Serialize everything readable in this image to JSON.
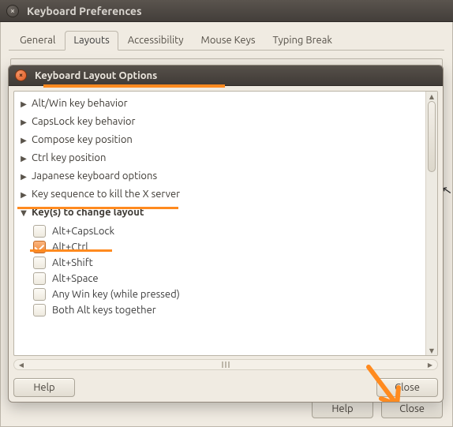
{
  "outer": {
    "title": "Keyboard Preferences",
    "tabs": [
      "General",
      "Layouts",
      "Accessibility",
      "Mouse Keys",
      "Typing Break"
    ],
    "active_tab_index": 1,
    "help_label": "Help",
    "close_label": "Close"
  },
  "dialog": {
    "title": "Keyboard Layout Options",
    "groups": [
      {
        "label": "Alt/Win key behavior",
        "expanded": false
      },
      {
        "label": "CapsLock key behavior",
        "expanded": false
      },
      {
        "label": "Compose key position",
        "expanded": false
      },
      {
        "label": "Ctrl key position",
        "expanded": false
      },
      {
        "label": "Japanese keyboard options",
        "expanded": false
      },
      {
        "label": "Key sequence to kill the X server",
        "expanded": false
      },
      {
        "label": "Key(s) to change layout",
        "expanded": true
      }
    ],
    "layout_keys_options": [
      {
        "label": "Alt+CapsLock",
        "checked": false
      },
      {
        "label": "Alt+Ctrl",
        "checked": true
      },
      {
        "label": "Alt+Shift",
        "checked": false
      },
      {
        "label": "Alt+Space",
        "checked": false
      },
      {
        "label": "Any Win key (while pressed)",
        "checked": false
      },
      {
        "label": "Both Alt keys together",
        "checked": false
      }
    ],
    "help_label": "Help",
    "close_label": "Close"
  },
  "annotation": {
    "color": "#ff8a1f"
  }
}
